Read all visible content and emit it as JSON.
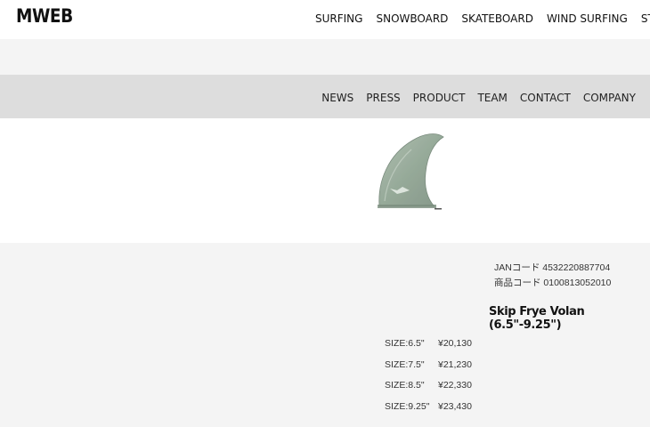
{
  "brand": {
    "logo": "MWEB"
  },
  "main_nav": [
    "SURFING",
    "SNOWBOARD",
    "SKATEBOARD",
    "WIND SURFING",
    "STAND UP PADDLE BOARD"
  ],
  "sub_nav": [
    "NEWS",
    "PRESS",
    "PRODUCT",
    "TEAM",
    "CONTACT",
    "COMPANY"
  ],
  "product": {
    "jan_code": "JANコード 4532220887704",
    "item_code": "商品コード 0100813052010",
    "name": "Skip Frye Volan (6.5\"-9.25\")",
    "image_icon": "surf-fin-image",
    "sizes": [
      {
        "size": "SIZE:6.5\"",
        "price": "¥20,130"
      },
      {
        "size": "SIZE:7.5\"",
        "price": "¥21,230"
      },
      {
        "size": "SIZE:8.5\"",
        "price": "¥22,330"
      },
      {
        "size": "SIZE:9.25\"",
        "price": "¥23,430"
      }
    ]
  },
  "colors": {
    "nav_band": "#dddddd",
    "light_band": "#f4f4f4",
    "fin": "#8ea391"
  }
}
